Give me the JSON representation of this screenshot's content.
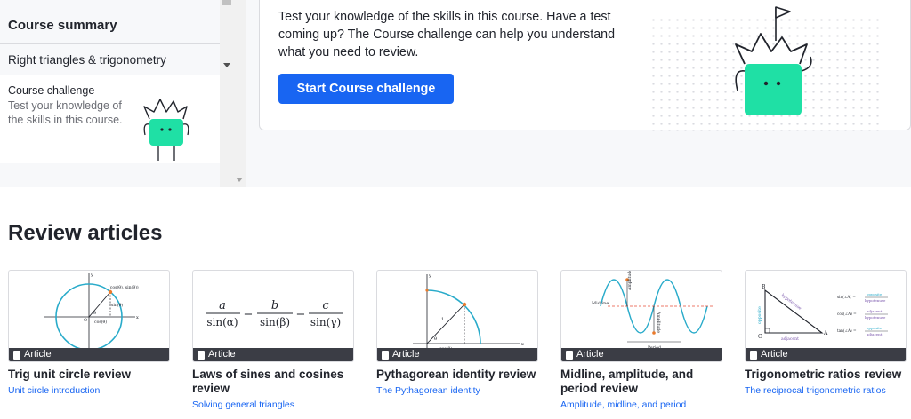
{
  "sidebar": {
    "summary_label": "Course summary",
    "unit_label": "Right triangles & trigonometry",
    "challenge_title": "Course challenge",
    "challenge_desc": "Test your knowledge of the skills in this course."
  },
  "challenge": {
    "description": "Test your knowledge of the skills in this course. Have a test coming up? The Course challenge can help you understand what you need to review.",
    "button_label": "Start Course challenge"
  },
  "review": {
    "title": "Review articles",
    "articles": [
      {
        "badge": "Article",
        "title": "Trig unit circle review",
        "link": "Unit circle introduction",
        "icon": "unit-circle-diagram"
      },
      {
        "badge": "Article",
        "title": "Laws of sines and cosines review",
        "link": "Solving general triangles",
        "icon": "law-of-sines-formula"
      },
      {
        "badge": "Article",
        "title": "Pythagorean identity review",
        "link": "The Pythagorean identity",
        "icon": "quarter-circle-diagram"
      },
      {
        "badge": "Article",
        "title": "Midline, amplitude, and period review",
        "link": "Amplitude, midline, and period",
        "icon": "sine-wave-diagram"
      },
      {
        "badge": "Article",
        "title": "Trigonometric ratios review",
        "link": "The reciprocal trigonometric ratios",
        "icon": "right-triangle-diagram"
      }
    ]
  },
  "thumbs": {
    "unit_circle": {
      "point": "(cos(θ), sin(θ))",
      "sin": "sin(θ)",
      "cos": "cos(θ)",
      "theta": "θ",
      "origin": "O",
      "x": "x",
      "y": "y"
    },
    "law_sines": {
      "a": "a",
      "b": "b",
      "c": "c",
      "den_a": "sin(α)",
      "den_b": "sin(β)",
      "den_c": "sin(γ)",
      "eq": "="
    },
    "pythagorean": {
      "one": "1",
      "theta": "θ",
      "cos": "cos(θ)",
      "x": "x",
      "y": "y"
    },
    "sine": {
      "midline": "Midline",
      "amplitude": "Amplitude",
      "period": "Period"
    },
    "ratios": {
      "A": "A",
      "B": "B",
      "C": "C",
      "opposite": "opposite",
      "hypotenuse": "hypotenuse",
      "adjacent": "adjacent",
      "sin": "sin(∠A) =",
      "cos": "cos(∠A) =",
      "tan": "tan(∠A) ="
    }
  },
  "colors": {
    "accent": "#1865f2",
    "mascot": "#1fe0a5",
    "badge_bg": "#3b3d45",
    "curve": "#29abca",
    "point": "#ea7a2b"
  }
}
